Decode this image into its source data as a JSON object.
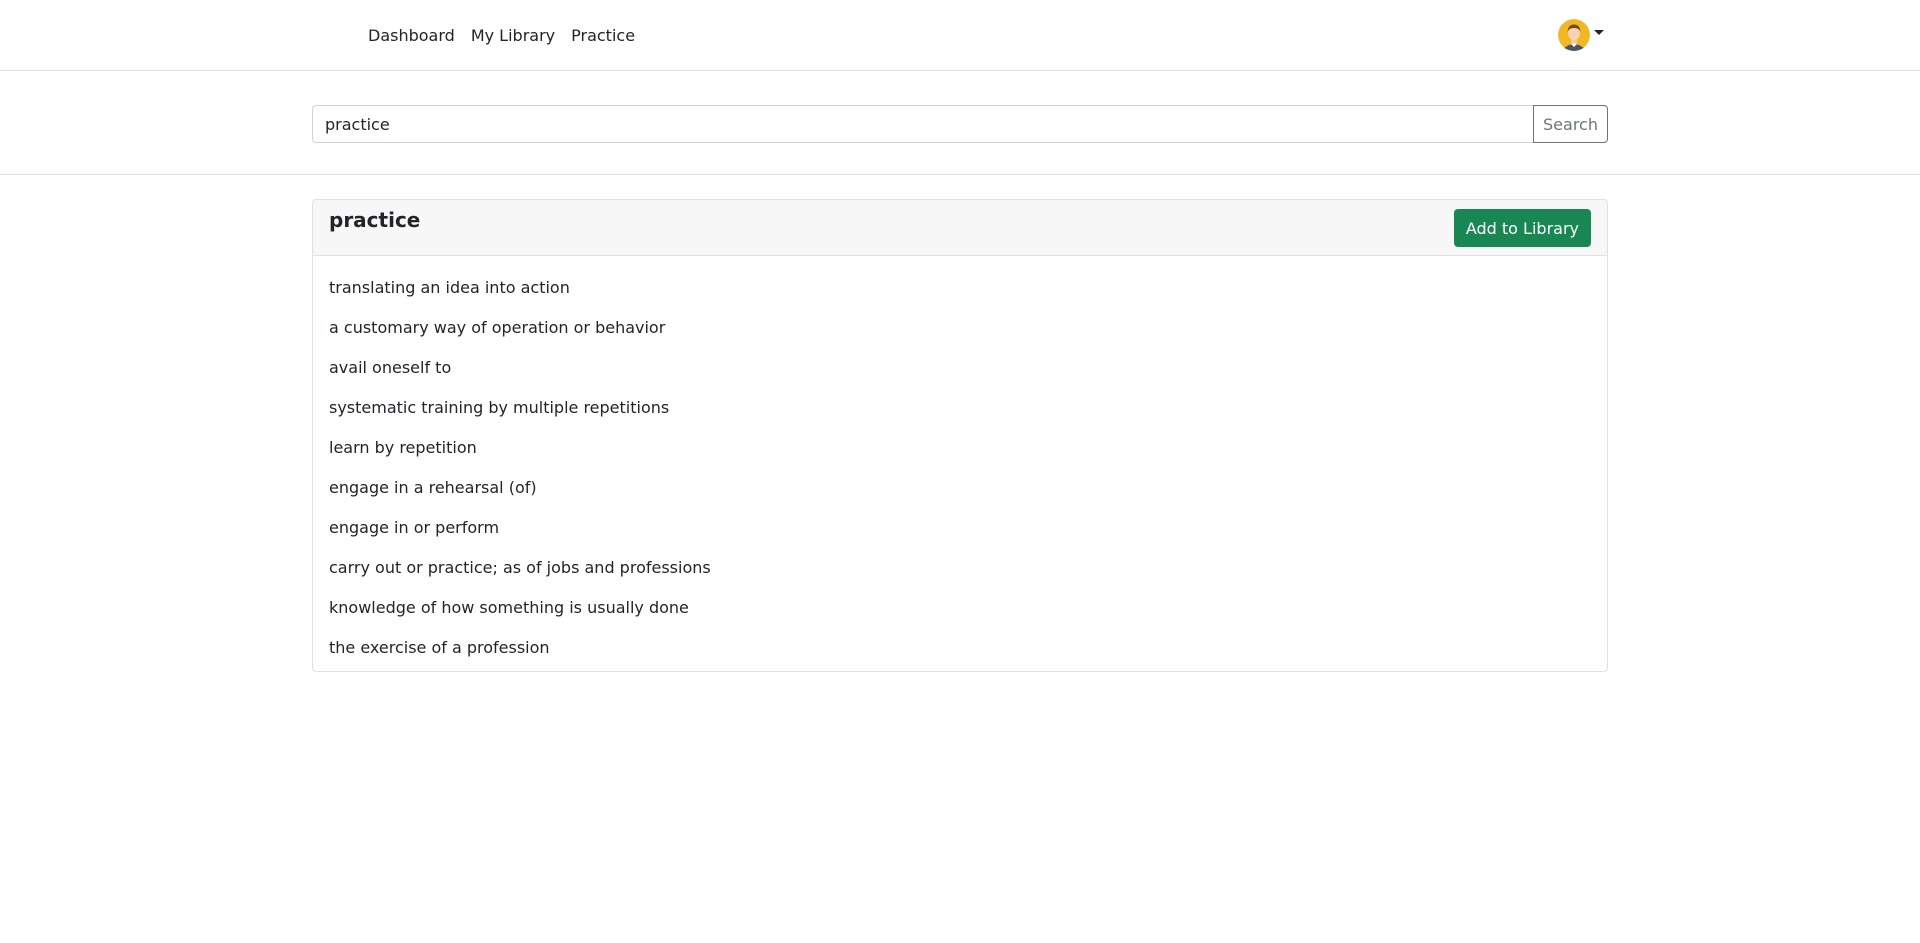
{
  "nav": {
    "links": [
      "Dashboard",
      "My Library",
      "Practice"
    ],
    "user_icon": "user-avatar-icon"
  },
  "search": {
    "value": "practice",
    "button_label": "Search"
  },
  "result": {
    "word": "practice",
    "add_label": "Add to Library",
    "definitions": [
      "translating an idea into action",
      "a customary way of operation or behavior",
      "avail oneself to",
      "systematic training by multiple repetitions",
      "learn by repetition",
      "engage in a rehearsal (of)",
      "engage in or perform",
      "carry out or practice; as of jobs and professions",
      "knowledge of how something is usually done",
      "the exercise of a profession"
    ]
  },
  "colors": {
    "accent_green": "#198754",
    "border": "#dee2e6",
    "header_bg": "#f7f7f7"
  }
}
